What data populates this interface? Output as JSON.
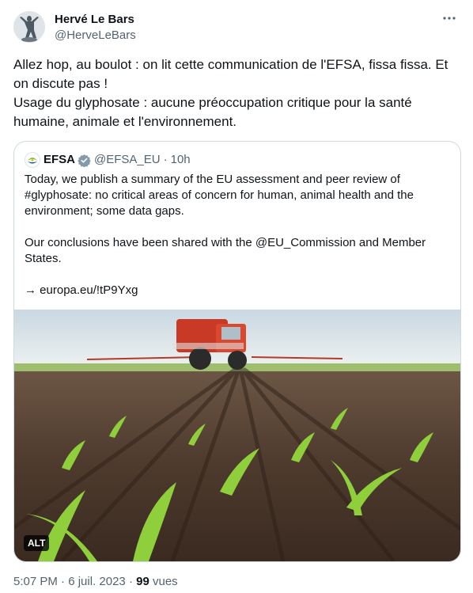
{
  "author": {
    "name": "Hervé Le Bars",
    "handle": "@HerveLeBars"
  },
  "more_icon": "more-horizontal-icon",
  "tweet": {
    "text": "Allez hop, au boulot : on lit cette communication de l'EFSA, fissa fissa. Et on discute pas !\nUsage du glyphosate : aucune préoccupation critique pour la santé humaine, animale et l'environnement."
  },
  "quote": {
    "name": "EFSA",
    "handle": "@EFSA_EU",
    "separator": "·",
    "time": "10h",
    "text": "Today, we publish a summary of the EU assessment and peer review of #glyphosate: no critical areas of concern for human, animal health and the environment; some data gaps.\n\nOur conclusions have been shared with the @EU_Commission and Member States.\n\n→ europa.eu/!tP9Yxg",
    "image_alt_label": "ALT"
  },
  "footer": {
    "time": "5:07 PM",
    "separator": "·",
    "date": "6 juil. 2023",
    "views_count": "99",
    "views_label": "vues"
  },
  "colors": {
    "text": "#0f1419",
    "secondary": "#536471",
    "border": "#cfd9de",
    "verified": "#829aab"
  }
}
